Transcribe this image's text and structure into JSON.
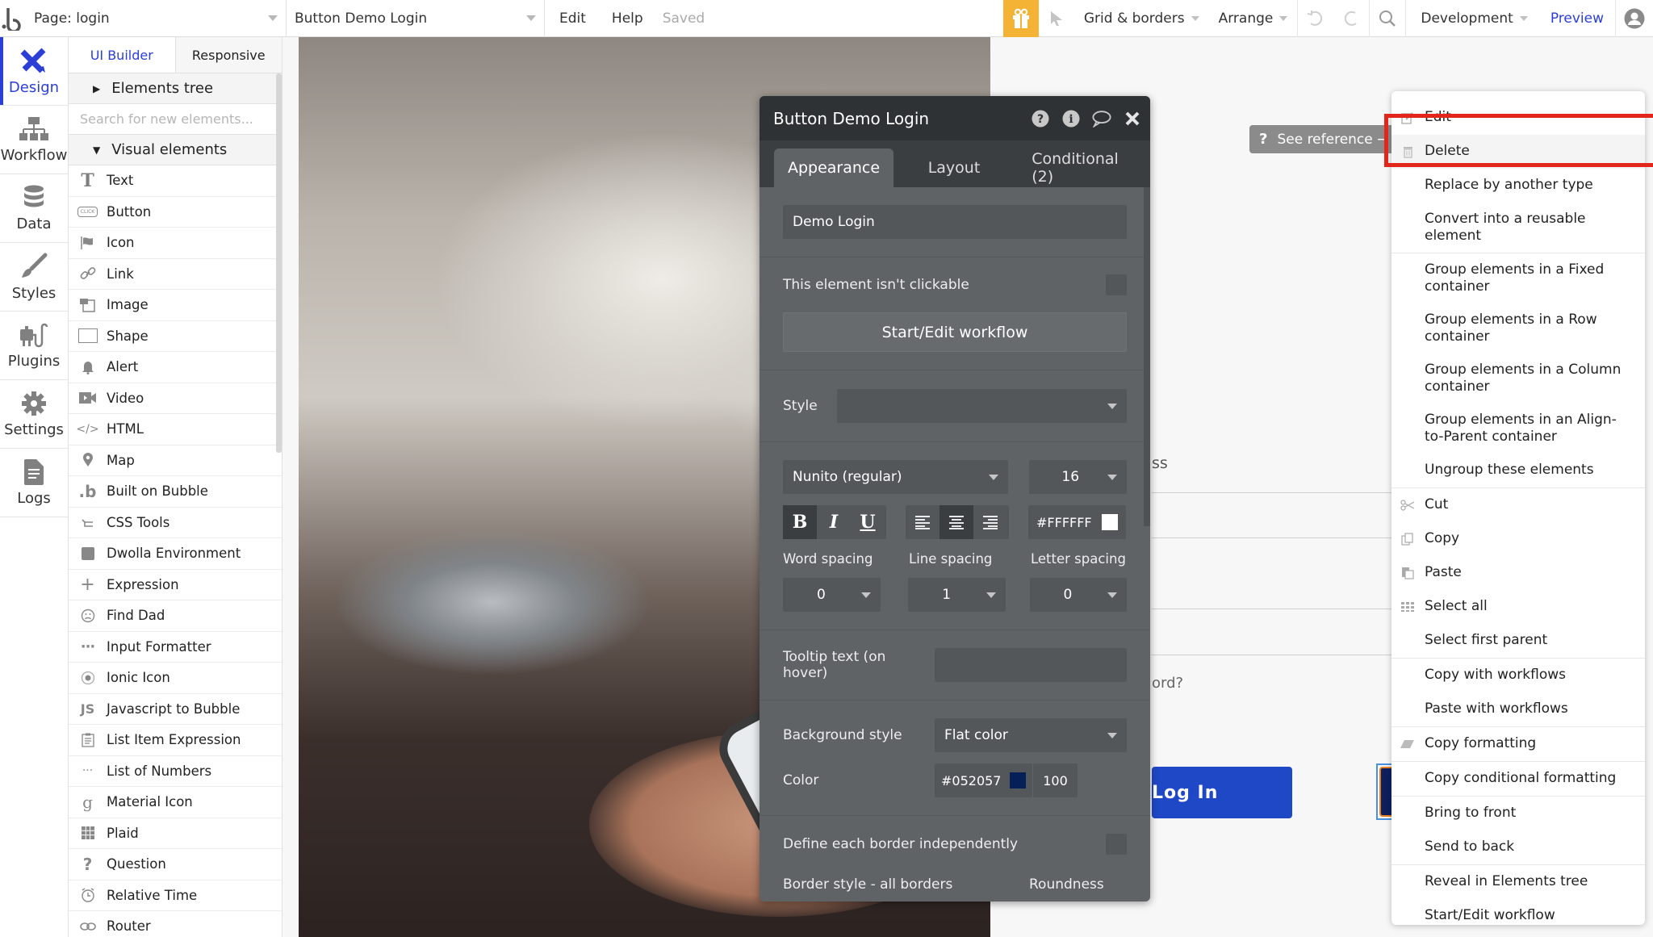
{
  "topbar": {
    "page_label": "Page: login",
    "element_label": "Button Demo Login",
    "menu_edit": "Edit",
    "menu_help": "Help",
    "status": "Saved",
    "grid_label": "Grid & borders",
    "arrange_label": "Arrange",
    "env_label": "Development",
    "preview_label": "Preview",
    "accent_color": "#f5b335",
    "link_color": "#2b3fd6"
  },
  "rail": {
    "items": [
      {
        "label": "Design",
        "icon": "design-icon",
        "active": true
      },
      {
        "label": "Workflow",
        "icon": "workflow-icon"
      },
      {
        "label": "Data",
        "icon": "database-icon"
      },
      {
        "label": "Styles",
        "icon": "brush-icon"
      },
      {
        "label": "Plugins",
        "icon": "plug-icon"
      },
      {
        "label": "Settings",
        "icon": "gear-icon"
      },
      {
        "label": "Logs",
        "icon": "document-icon"
      }
    ]
  },
  "panel": {
    "tabs": [
      "UI Builder",
      "Responsive"
    ],
    "elements_tree": "Elements tree",
    "search_placeholder": "Search for new elements...",
    "visual_elements": "Visual elements",
    "items": [
      {
        "label": "Text",
        "icon": "T"
      },
      {
        "label": "Button",
        "icon": "CLICK"
      },
      {
        "label": "Icon",
        "icon": "flag"
      },
      {
        "label": "Link",
        "icon": "link"
      },
      {
        "label": "Image",
        "icon": "image"
      },
      {
        "label": "Shape",
        "icon": "square"
      },
      {
        "label": "Alert",
        "icon": "bell"
      },
      {
        "label": "Video",
        "icon": "video"
      },
      {
        "label": "HTML",
        "icon": "</>"
      },
      {
        "label": "Map",
        "icon": "pin"
      },
      {
        "label": "Built on Bubble",
        "icon": "b"
      },
      {
        "label": "CSS Tools",
        "icon": "return"
      },
      {
        "label": "Dwolla Environment",
        "icon": "block"
      },
      {
        "label": "Expression",
        "icon": "+"
      },
      {
        "label": "Find Dad",
        "icon": "frown"
      },
      {
        "label": "Input Formatter",
        "icon": "dots"
      },
      {
        "label": "Ionic Icon",
        "icon": "radio"
      },
      {
        "label": "Javascript to Bubble",
        "icon": "JS"
      },
      {
        "label": "List Item Expression",
        "icon": "clipboard"
      },
      {
        "label": "List of Numbers",
        "icon": "ellipsis"
      },
      {
        "label": "Material Icon",
        "icon": "g"
      },
      {
        "label": "Plaid",
        "icon": "grid"
      },
      {
        "label": "Question",
        "icon": "?"
      },
      {
        "label": "Relative Time",
        "icon": "clock"
      },
      {
        "label": "Router",
        "icon": "chain"
      }
    ]
  },
  "canvas": {
    "email_label_fragment": "ss",
    "forgot_fragment": "ord?",
    "login_button": "Log In",
    "login_color": "#1f48c6",
    "demo_button_color": "#0e1f5c"
  },
  "editor": {
    "title": "Button Demo Login",
    "tabs": [
      "Appearance",
      "Layout",
      "Conditional (2)"
    ],
    "button_text": "Demo Login",
    "not_clickable_label": "This element isn't clickable",
    "workflow_button": "Start/Edit workflow",
    "style_label": "Style",
    "style_value": "",
    "font_value": "Nunito (regular)",
    "font_size": "16",
    "bold": "B",
    "italic": "I",
    "underline": "U",
    "text_color": "#FFFFFF",
    "word_spacing_label": "Word spacing",
    "line_spacing_label": "Line spacing",
    "letter_spacing_label": "Letter spacing",
    "word_spacing": "0",
    "line_spacing": "1",
    "letter_spacing": "0",
    "tooltip_label": "Tooltip text (on hover)",
    "tooltip_value": "",
    "bg_style_label": "Background style",
    "bg_style_value": "Flat color",
    "color_label": "Color",
    "color_value": "#052057",
    "color_opacity": "100",
    "border_independent_label": "Define each border independently",
    "border_style_label": "Border style - all borders",
    "roundness_label": "Roundness"
  },
  "tooltip": {
    "icon": "?",
    "label": "See reference →"
  },
  "context_menu": {
    "items": [
      {
        "label": "Edit",
        "icon": "edit-icon"
      },
      {
        "label": "Delete",
        "icon": "trash-icon",
        "highlighted": true
      },
      {
        "label": "Replace by another type"
      },
      {
        "label": "Convert into a reusable element"
      },
      {
        "label": "Group elements in a Fixed container"
      },
      {
        "label": "Group elements in a Row container"
      },
      {
        "label": "Group elements in a Column container"
      },
      {
        "label": "Group elements in an Align-to-Parent container"
      },
      {
        "label": "Ungroup these elements"
      },
      {
        "label": "Cut",
        "icon": "scissors-icon"
      },
      {
        "label": "Copy",
        "icon": "copy-icon"
      },
      {
        "label": "Paste",
        "icon": "paste-icon"
      },
      {
        "label": "Select all",
        "icon": "grid-icon"
      },
      {
        "label": "Select first parent"
      },
      {
        "label": "Copy with workflows"
      },
      {
        "label": "Paste with workflows"
      },
      {
        "label": "Copy formatting",
        "icon": "eraser-icon"
      },
      {
        "label": "Copy conditional formatting"
      },
      {
        "label": "Bring to front"
      },
      {
        "label": "Send to back"
      },
      {
        "label": "Reveal in Elements tree"
      },
      {
        "label": "Start/Edit workflow"
      }
    ],
    "highlight_color": "#e2261c"
  }
}
